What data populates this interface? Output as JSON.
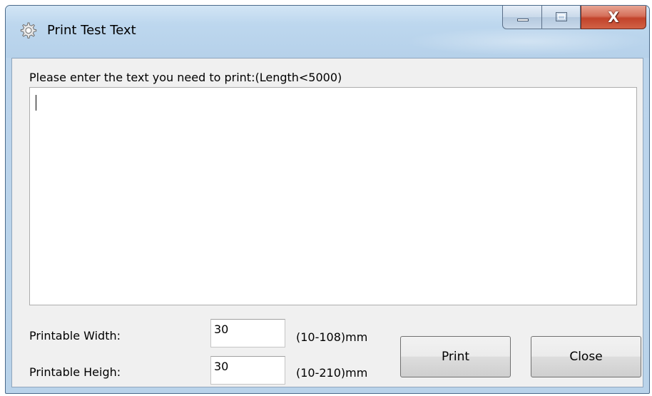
{
  "window": {
    "title": "Print Test Text",
    "close_glyph": "X",
    "accent": "#c2432b"
  },
  "prompt": {
    "label": "Please enter the text you need to print:(Length<5000)",
    "text_value": ""
  },
  "width_field": {
    "label": "Printable Width:",
    "value": "30",
    "range": "(10-108)mm"
  },
  "height_field": {
    "label": "Printable Heigh:",
    "value": "30",
    "range": "(10-210)mm"
  },
  "buttons": {
    "print": "Print",
    "close": "Close"
  },
  "icons": {
    "app": "gear-icon",
    "minimize": "minimize-icon",
    "maximize": "maximize-icon",
    "close": "close-icon"
  }
}
